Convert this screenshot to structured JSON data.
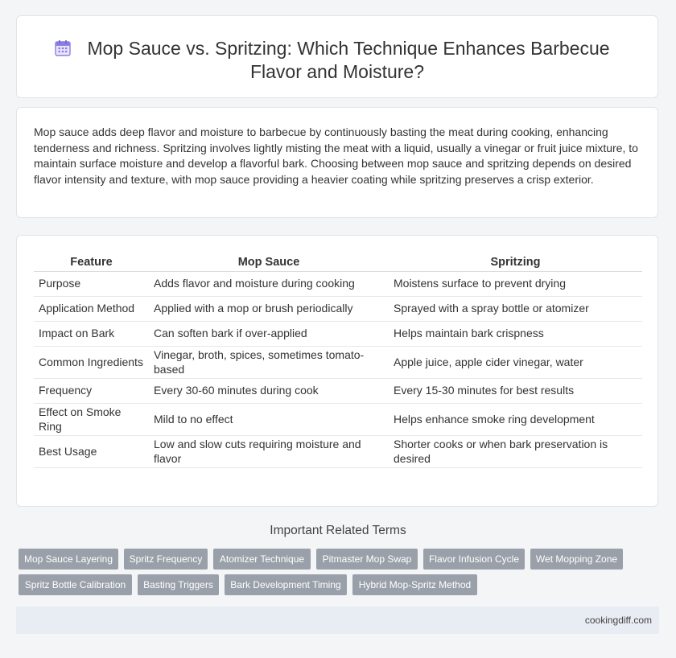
{
  "header": {
    "title_line1": "Mop Sauce vs. Spritzing: Which Technique Enhances Barbecue",
    "title_line2": "Flavor and Moisture?"
  },
  "intro": "Mop sauce adds deep flavor and moisture to barbecue by continuously basting the meat during cooking, enhancing tenderness and richness. Spritzing involves lightly misting the meat with a liquid, usually a vinegar or fruit juice mixture, to maintain surface moisture and develop a flavorful bark. Choosing between mop sauce and spritzing depends on desired flavor intensity and texture, with mop sauce providing a heavier coating while spritzing preserves a crisp exterior.",
  "table": {
    "headers": [
      "Feature",
      "Mop Sauce",
      "Spritzing"
    ],
    "rows": [
      [
        "Purpose",
        "Adds flavor and moisture during cooking",
        "Moistens surface to prevent drying"
      ],
      [
        "Application Method",
        "Applied with a mop or brush periodically",
        "Sprayed with a spray bottle or atomizer"
      ],
      [
        "Impact on Bark",
        "Can soften bark if over-applied",
        "Helps maintain bark crispness"
      ],
      [
        "Common Ingredients",
        "Vinegar, broth, spices, sometimes tomato-based",
        "Apple juice, apple cider vinegar, water"
      ],
      [
        "Frequency",
        "Every 30-60 minutes during cook",
        "Every 15-30 minutes for best results"
      ],
      [
        "Effect on Smoke Ring",
        "Mild to no effect",
        "Helps enhance smoke ring development"
      ],
      [
        "Best Usage",
        "Low and slow cuts requiring moisture and flavor",
        "Shorter cooks or when bark preservation is desired"
      ]
    ]
  },
  "related": {
    "title": "Important Related Terms",
    "tags": [
      "Mop Sauce Layering",
      "Spritz Frequency",
      "Atomizer Technique",
      "Pitmaster Mop Swap",
      "Flavor Infusion Cycle",
      "Wet Mopping Zone",
      "Spritz Bottle Calibration",
      "Basting Triggers",
      "Bark Development Timing",
      "Hybrid Mop-Spritz Method"
    ]
  },
  "footer": {
    "site": "cookingdiff.com"
  },
  "colors": {
    "tag_bg": "#9aa0a9",
    "footer_bg": "#e8ecf3",
    "icon_accent": "#7b6fd6"
  }
}
